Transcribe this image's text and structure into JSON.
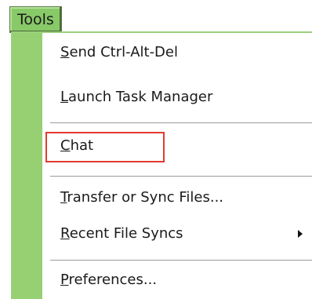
{
  "menubar": {
    "tools_label": "Tools"
  },
  "menu": {
    "items": [
      {
        "mnemonic": "S",
        "rest": "end Ctrl-Alt-Del"
      },
      {
        "mnemonic": "L",
        "rest": "aunch Task Manager"
      },
      {
        "mnemonic": "C",
        "rest": "hat"
      },
      {
        "mnemonic": "T",
        "rest": "ransfer or Sync Files..."
      },
      {
        "mnemonic": "R",
        "rest": "ecent File Syncs"
      },
      {
        "mnemonic": "P",
        "rest": "references..."
      }
    ]
  },
  "colors": {
    "menubar_bg": "#88c968",
    "gutter": "#96d072",
    "highlight_box": "#e23b2e"
  },
  "icons": {
    "submenu_arrow": "chevron-right-icon"
  }
}
